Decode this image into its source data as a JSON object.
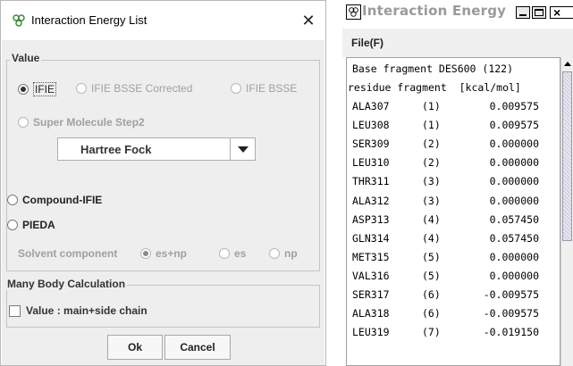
{
  "dialog": {
    "title": "Interaction Energy List",
    "close_glyph": "✕",
    "value_group": {
      "label": "Value",
      "options": [
        {
          "label": "IFIE",
          "selected": true,
          "enabled": true
        },
        {
          "label": "IFIE BSSE Corrected",
          "selected": false,
          "enabled": false
        },
        {
          "label": "IFIE BSSE",
          "selected": false,
          "enabled": false
        },
        {
          "label": "Super Molecule Step2",
          "selected": false,
          "enabled": false
        },
        {
          "label": "Compound-IFIE",
          "selected": false,
          "enabled": true
        },
        {
          "label": "PIEDA",
          "selected": false,
          "enabled": true
        }
      ],
      "method_select": "Hartree Fock",
      "solvent": {
        "label": "Solvent component",
        "options": [
          {
            "label": "es+np",
            "selected": true
          },
          {
            "label": "es",
            "selected": false
          },
          {
            "label": "np",
            "selected": false
          }
        ]
      }
    },
    "many_body_group": {
      "label": "Many Body Calculation",
      "checkbox_label": "Value : main+side chain",
      "checked": false
    },
    "buttons": {
      "ok": "Ok",
      "cancel": "Cancel"
    }
  },
  "energy_window": {
    "title": "Interaction Energy",
    "menu": {
      "file": "File(F)"
    },
    "header_line": "Base fragment DES600 (122)",
    "columns_line": "residue fragment  [kcal/mol]",
    "rows": [
      {
        "residue": "ALA307",
        "fragment": "(1)",
        "value": "0.009575"
      },
      {
        "residue": "LEU308",
        "fragment": "(1)",
        "value": "0.009575"
      },
      {
        "residue": "SER309",
        "fragment": "(2)",
        "value": "0.000000"
      },
      {
        "residue": "LEU310",
        "fragment": "(2)",
        "value": "0.000000"
      },
      {
        "residue": "THR311",
        "fragment": "(3)",
        "value": "0.000000"
      },
      {
        "residue": "ALA312",
        "fragment": "(3)",
        "value": "0.000000"
      },
      {
        "residue": "ASP313",
        "fragment": "(4)",
        "value": "0.057450"
      },
      {
        "residue": "GLN314",
        "fragment": "(4)",
        "value": "0.057450"
      },
      {
        "residue": "MET315",
        "fragment": "(5)",
        "value": "0.000000"
      },
      {
        "residue": "VAL316",
        "fragment": "(5)",
        "value": "0.000000"
      },
      {
        "residue": "SER317",
        "fragment": "(6)",
        "value": "-0.009575"
      },
      {
        "residue": "ALA318",
        "fragment": "(6)",
        "value": "-0.009575"
      },
      {
        "residue": "LEU319",
        "fragment": "(7)",
        "value": "-0.019150"
      }
    ]
  }
}
